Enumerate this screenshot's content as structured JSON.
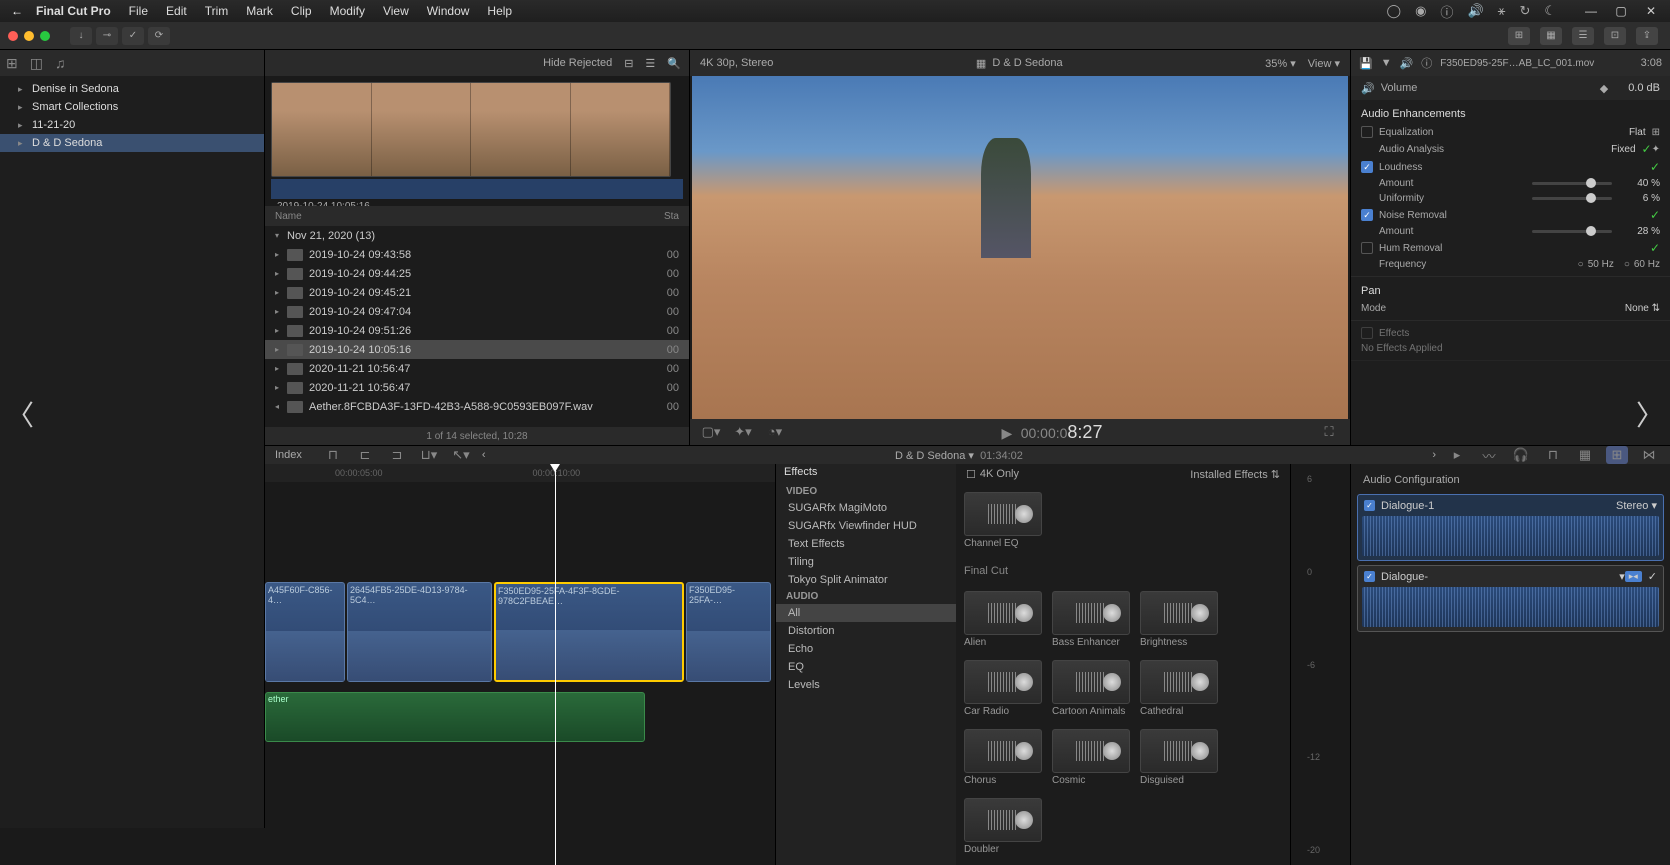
{
  "menubar": {
    "app": "Final Cut Pro",
    "items": [
      "File",
      "Edit",
      "Trim",
      "Mark",
      "Clip",
      "Modify",
      "View",
      "Window",
      "Help"
    ]
  },
  "sidebar": {
    "items": [
      {
        "label": "Denise in Sedona",
        "sel": false
      },
      {
        "label": "Smart Collections",
        "sel": false
      },
      {
        "label": "11-21-20",
        "sel": false
      },
      {
        "label": "D & D Sedona",
        "sel": true
      }
    ]
  },
  "browser": {
    "top": {
      "hide": "Hide Rejected"
    },
    "timestamp": "2019-10-24 10:05:16",
    "group": "Nov 21, 2020  (13)",
    "cols": {
      "name": "Name",
      "start": "Sta"
    },
    "clips": [
      {
        "name": "2019-10-24 09:43:58",
        "st": "00"
      },
      {
        "name": "2019-10-24 09:44:25",
        "st": "00"
      },
      {
        "name": "2019-10-24 09:45:21",
        "st": "00"
      },
      {
        "name": "2019-10-24 09:47:04",
        "st": "00"
      },
      {
        "name": "2019-10-24 09:51:26",
        "st": "00"
      },
      {
        "name": "2019-10-24 10:05:16",
        "st": "00",
        "sel": true
      },
      {
        "name": "2020-11-21 10:56:47",
        "st": "00"
      },
      {
        "name": "2020-11-21 10:56:47",
        "st": "00"
      },
      {
        "name": "Aether.8FCBDA3F-13FD-42B3-A588-9C0593EB097F.wav",
        "st": "00"
      }
    ],
    "footer": "1 of 14 selected, 10:28"
  },
  "viewer": {
    "format": "4K 30p, Stereo",
    "title": "D & D Sedona",
    "zoom": "35%",
    "view": "View",
    "file": "F350ED95-25F…AB_LC_001.mov",
    "duration": "3:08",
    "tc_small": "00:00:0",
    "tc_big": "8:27"
  },
  "inspector": {
    "volume": {
      "label": "Volume",
      "value": "0.0 dB"
    },
    "audio_enh": "Audio Enhancements",
    "eq": {
      "label": "Equalization",
      "value": "Flat"
    },
    "analysis": {
      "label": "Audio Analysis",
      "value": "Fixed"
    },
    "loudness": {
      "label": "Loudness",
      "on": true,
      "amount": {
        "label": "Amount",
        "value": "40 %"
      },
      "uniformity": {
        "label": "Uniformity",
        "value": "6 %"
      }
    },
    "noise": {
      "label": "Noise Removal",
      "on": true,
      "amount": {
        "label": "Amount",
        "value": "28 %"
      }
    },
    "hum": {
      "label": "Hum Removal",
      "on": false,
      "freq": {
        "label": "Frequency",
        "v1": "50 Hz",
        "v2": "60 Hz"
      }
    },
    "pan": {
      "label": "Pan",
      "mode_l": "Mode",
      "mode_v": "None"
    },
    "effects": {
      "label": "Effects",
      "none": "No Effects Applied"
    }
  },
  "timeline": {
    "index": "Index",
    "project": "D & D Sedona",
    "duration": "01:34:02",
    "ruler": [
      "00:00:05:00",
      "00:00:10:00"
    ],
    "clips": [
      "A45F60F-C856-4…",
      "26454FB5-25DE-4D13-9784-5C4…",
      "F350ED95-25FA-4F3F-8GDE-978C2FBEAE…",
      "F350ED95-25FA-…"
    ],
    "aclip": "ether"
  },
  "effects": {
    "header": "Effects",
    "only4k": "4K Only",
    "installed": "Installed Effects",
    "video_cat": "VIDEO",
    "video_items": [
      "SUGARfx MagiMoto",
      "SUGARfx Viewfinder HUD",
      "Text Effects",
      "Tiling",
      "Tokyo Split Animator"
    ],
    "audio_cat": "AUDIO",
    "audio_items": [
      "All",
      "Distortion",
      "Echo",
      "EQ",
      "Levels"
    ],
    "selected": "All",
    "thumb1": "Channel EQ",
    "fc_cat": "Final Cut",
    "thumbs": [
      "Alien",
      "Bass Enhancer",
      "Brightness",
      "Car Radio",
      "Cartoon Animals",
      "Cathedral",
      "Chorus",
      "Cosmic",
      "Disguised",
      "Doubler"
    ]
  },
  "meters": {
    "scale": [
      "6",
      "0",
      "-6",
      "-12",
      "-20"
    ]
  },
  "audio_config": {
    "header": "Audio Configuration",
    "lanes": [
      {
        "name": "Dialogue-1",
        "mode": "Stereo"
      },
      {
        "name": "Dialogue-",
        "mode": ""
      }
    ]
  }
}
